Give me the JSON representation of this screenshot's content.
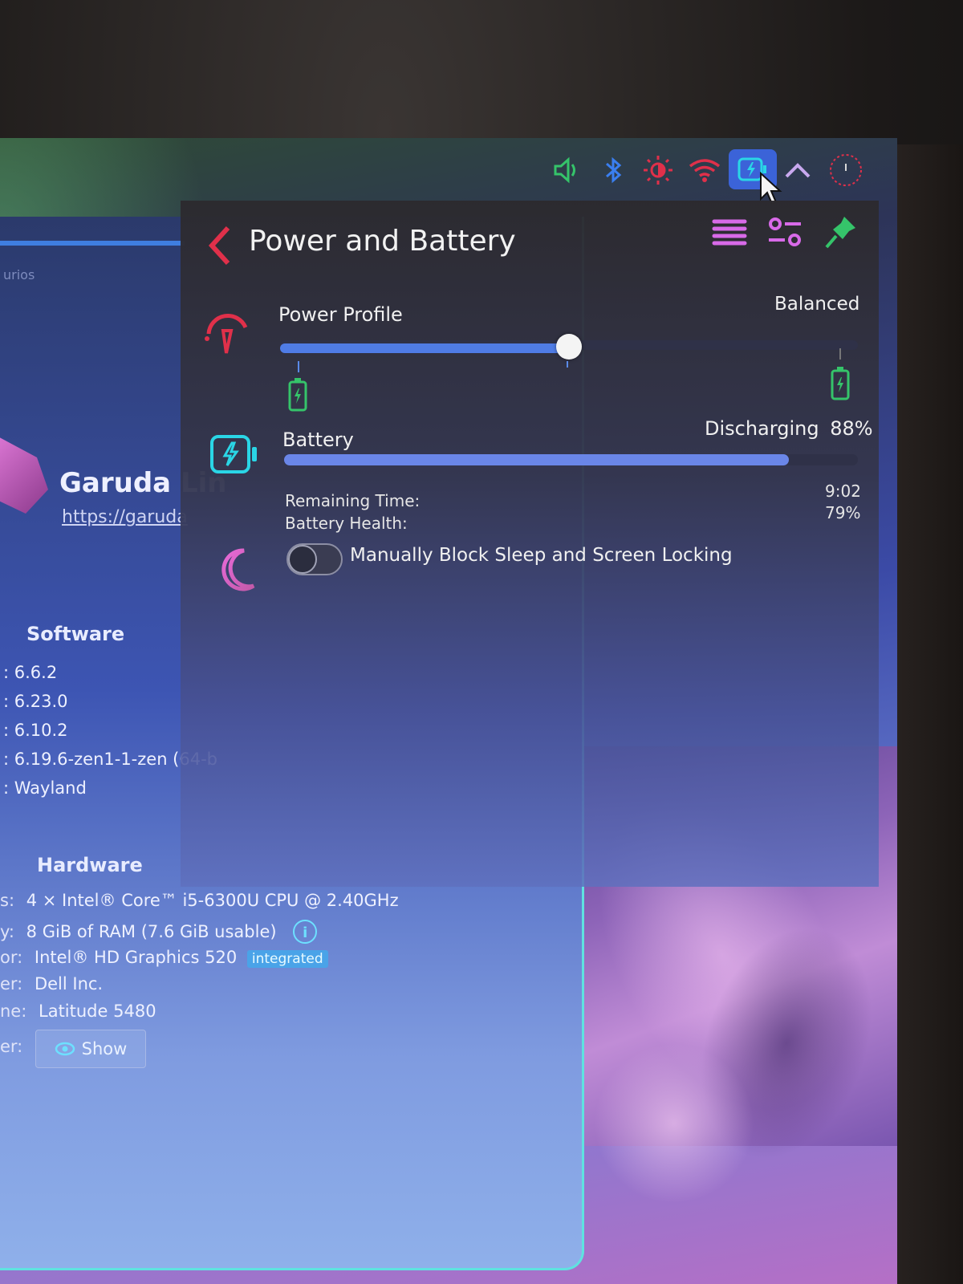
{
  "popup": {
    "title": "Power and Battery",
    "power_profile": {
      "label": "Power Profile",
      "value_label": "Balanced",
      "level": 0.5
    },
    "battery": {
      "label": "Battery",
      "status": "Discharging",
      "percent": "88%",
      "level": 0.88,
      "remaining_label": "Remaining Time:",
      "remaining_value": "9:02",
      "health_label": "Battery Health:",
      "health_value": "79%"
    },
    "sleep_toggle": {
      "label": "Manually Block Sleep and Screen Locking",
      "on": false
    }
  },
  "system_info": {
    "os_name": "Garuda Lin",
    "os_url": "https://garuda",
    "field_placeholder": "urios",
    "software_heading": "Software",
    "software_rows": [
      ": 6.6.2",
      ": 6.23.0",
      ": 6.10.2",
      ": 6.19.6-zen1-1-zen (64-b",
      ": Wayland"
    ],
    "hardware_heading": "Hardware",
    "hardware_rows": [
      {
        "key": "s:",
        "value": "4 × Intel® Core™ i5-6300U CPU @ 2.40GHz"
      },
      {
        "key": "y:",
        "value": "8 GiB of RAM (7.6 GiB usable)"
      },
      {
        "key": "or:",
        "value": "Intel® HD Graphics 520"
      },
      {
        "key": "er:",
        "value": "Dell Inc."
      },
      {
        "key": "ne:",
        "value": "Latitude 5480"
      },
      {
        "key": "er:",
        "value": ""
      }
    ],
    "gpu_badge": "integrated",
    "show_button": "Show"
  },
  "tray_icons": [
    "volume-icon",
    "bluetooth-icon",
    "brightness-icon",
    "wifi-icon",
    "battery-icon",
    "expand-arrow-icon",
    "clock-icon"
  ],
  "colors": {
    "accent_blue": "#4f7ce6",
    "icon_red": "#e0304a",
    "icon_green": "#35c46a",
    "icon_cyan": "#2ad6e6",
    "icon_pink": "#d86ae8"
  }
}
